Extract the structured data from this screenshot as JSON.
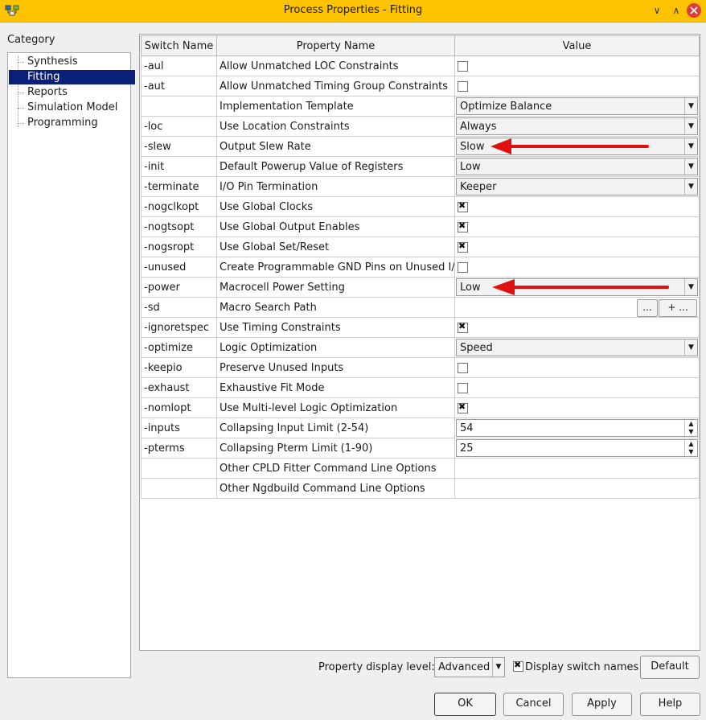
{
  "window": {
    "title": "Process Properties - Fitting"
  },
  "titlebar": {
    "minimize": "∨",
    "maximize": "∧"
  },
  "category": {
    "label": "Category",
    "items": [
      {
        "label": "Synthesis",
        "selected": false
      },
      {
        "label": "Fitting",
        "selected": true
      },
      {
        "label": "Reports",
        "selected": false
      },
      {
        "label": "Simulation Model",
        "selected": false
      },
      {
        "label": "Programming",
        "selected": false
      }
    ]
  },
  "table": {
    "headers": {
      "switch": "Switch Name",
      "property": "Property Name",
      "value": "Value"
    },
    "rows": [
      {
        "switch": "-aul",
        "property": "Allow Unmatched LOC Constraints",
        "type": "checkbox",
        "checked": false
      },
      {
        "switch": "-aut",
        "property": "Allow Unmatched Timing Group Constraints",
        "type": "checkbox",
        "checked": false
      },
      {
        "switch": "",
        "property": "Implementation Template",
        "type": "combo",
        "value": "Optimize Balance"
      },
      {
        "switch": "-loc",
        "property": "Use Location Constraints",
        "type": "combo",
        "value": "Always"
      },
      {
        "switch": "-slew",
        "property": "Output Slew Rate",
        "type": "combo",
        "value": "Slow",
        "highlight_arrow": true
      },
      {
        "switch": "-init",
        "property": "Default Powerup Value of Registers",
        "type": "combo",
        "value": "Low"
      },
      {
        "switch": "-terminate",
        "property": "I/O Pin Termination",
        "type": "combo",
        "value": "Keeper"
      },
      {
        "switch": "-nogclkopt",
        "property": "Use Global Clocks",
        "type": "checkbox",
        "checked": true
      },
      {
        "switch": "-nogtsopt",
        "property": "Use Global Output Enables",
        "type": "checkbox",
        "checked": true
      },
      {
        "switch": "-nogsropt",
        "property": "Use Global Set/Reset",
        "type": "checkbox",
        "checked": true
      },
      {
        "switch": "-unused",
        "property": "Create Programmable GND Pins on Unused I/O",
        "type": "checkbox",
        "checked": false
      },
      {
        "switch": "-power",
        "property": "Macrocell Power Setting",
        "type": "combo",
        "value": "Low",
        "highlight_arrow": true
      },
      {
        "switch": "-sd",
        "property": "Macro Search Path",
        "type": "path",
        "browse_label": "...",
        "add_label": "+ ..."
      },
      {
        "switch": "-ignoretspec",
        "property": "Use Timing Constraints",
        "type": "checkbox",
        "checked": true
      },
      {
        "switch": "-optimize",
        "property": "Logic Optimization",
        "type": "combo",
        "value": "Speed"
      },
      {
        "switch": "-keepio",
        "property": "Preserve Unused Inputs",
        "type": "checkbox",
        "checked": false
      },
      {
        "switch": "-exhaust",
        "property": "Exhaustive Fit Mode",
        "type": "checkbox",
        "checked": false
      },
      {
        "switch": "-nomlopt",
        "property": "Use Multi-level Logic Optimization",
        "type": "checkbox",
        "checked": true
      },
      {
        "switch": "-inputs",
        "property": "Collapsing Input Limit (2-54)",
        "type": "spin",
        "value": "54"
      },
      {
        "switch": "-pterms",
        "property": "Collapsing Pterm Limit (1-90)",
        "type": "spin",
        "value": "25"
      },
      {
        "switch": "",
        "property": "Other CPLD Fitter Command Line Options",
        "type": "text",
        "value": ""
      },
      {
        "switch": "",
        "property": "Other Ngdbuild Command Line Options",
        "type": "text",
        "value": ""
      }
    ]
  },
  "footer": {
    "display_level_label": "Property display level:",
    "display_level_value": "Advanced",
    "display_switch_names_label": "Display switch names",
    "display_switch_names_checked": true,
    "default_label": "Default",
    "ok_label": "OK",
    "cancel_label": "Cancel",
    "apply_label": "Apply",
    "help_label": "Help"
  },
  "colors": {
    "titlebar": "#fdc301",
    "selection": "#0a1f78",
    "arrow": "#e01010",
    "close": "#e03c3c"
  }
}
